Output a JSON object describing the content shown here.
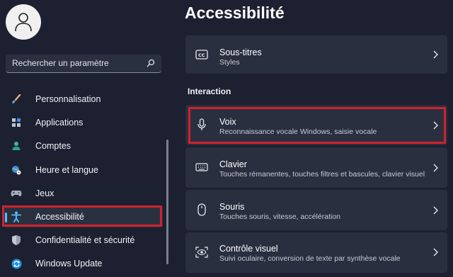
{
  "sidebar": {
    "search_placeholder": "Rechercher un paramètre",
    "items": [
      {
        "label": "Personnalisation",
        "icon": "paintbrush-icon"
      },
      {
        "label": "Applications",
        "icon": "apps-icon"
      },
      {
        "label": "Comptes",
        "icon": "user-icon"
      },
      {
        "label": "Heure et langue",
        "icon": "globe-clock-icon"
      },
      {
        "label": "Jeux",
        "icon": "gamepad-icon"
      },
      {
        "label": "Accessibilité",
        "icon": "accessibility-icon",
        "active": true
      },
      {
        "label": "Confidentialité et sécurité",
        "icon": "shield-icon"
      },
      {
        "label": "Windows Update",
        "icon": "update-icon"
      }
    ]
  },
  "main": {
    "title": "Accessibilité",
    "top_card": {
      "title": "Sous-titres",
      "subtitle": "Styles",
      "icon": "captions-icon"
    },
    "section_label": "Interaction",
    "cards": [
      {
        "title": "Voix",
        "subtitle": "Reconnaissance vocale Windows, saisie vocale",
        "icon": "microphone-icon",
        "highlighted": true
      },
      {
        "title": "Clavier",
        "subtitle": "Touches rémanentes, touches filtres et bascules, clavier visuel",
        "icon": "keyboard-icon"
      },
      {
        "title": "Souris",
        "subtitle": "Touches souris, vitesse, accélération",
        "icon": "mouse-icon"
      },
      {
        "title": "Contrôle visuel",
        "subtitle": "Suivi oculaire, conversion de texte par synthèse vocale",
        "icon": "eye-control-icon"
      }
    ]
  },
  "colors": {
    "background": "#1c2030",
    "card": "#2a2f40",
    "accent": "#4cc2ff",
    "highlight_red": "#d0222b"
  }
}
